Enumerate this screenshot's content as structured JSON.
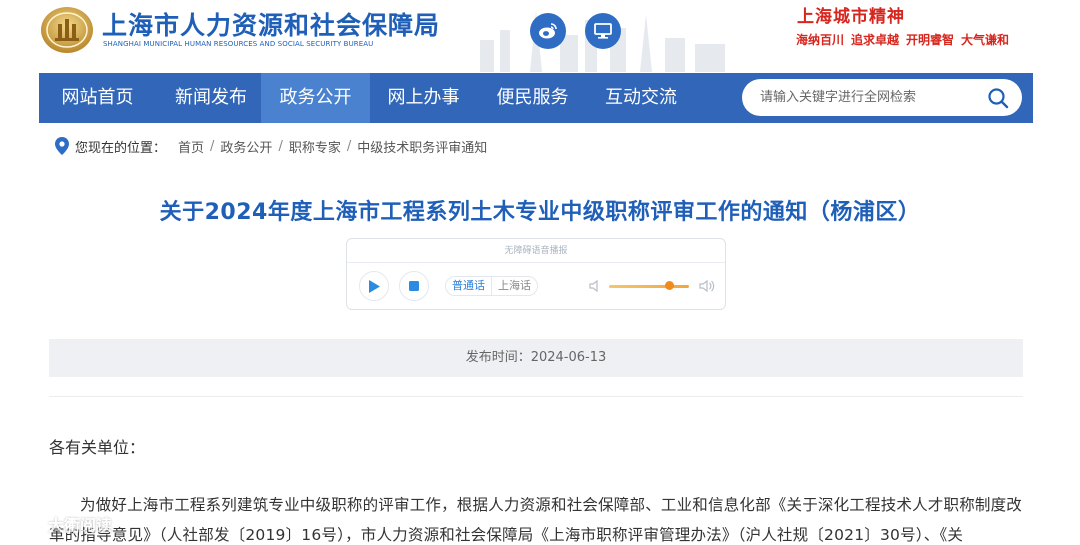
{
  "header": {
    "title": "上海市人力资源和社会保障局",
    "subtitle": "SHANGHAI MUNICIPAL HUMAN RESOURCES AND SOCIAL SECURITY BUREAU",
    "weibo_icon": "weibo-icon",
    "desktop_icon": "desktop-icon",
    "spirit": {
      "title": "上海城市精神",
      "phrases": [
        "海纳百川",
        "追求卓越",
        "开明睿智",
        "大气谦和"
      ]
    }
  },
  "nav": {
    "items": [
      {
        "label": "网站首页"
      },
      {
        "label": "新闻发布"
      },
      {
        "label": "政务公开",
        "active": true
      },
      {
        "label": "网上办事"
      },
      {
        "label": "便民服务"
      },
      {
        "label": "互动交流"
      }
    ],
    "search": {
      "placeholder": "请输入关键字进行全网检索"
    }
  },
  "breadcrumb": {
    "location_label": "您现在的位置：",
    "items": [
      "首页",
      "政务公开",
      "职称专家",
      "中级技术职务评审通知"
    ]
  },
  "article": {
    "title": "关于2024年度上海市工程系列土木专业中级职称评审工作的通知（杨浦区）",
    "publish": "发布时间：2024-06-13",
    "salutation": "各有关单位：",
    "paragraph": "为做好上海市工程系列建筑专业中级职称的评审工作，根据人力资源和社会保障部、工业和信息化部《关于深化工程技术人才职称制度改革的指导意见》（人社部发〔2019〕16号），市人力资源和社会保障局《上海市职称评审管理办法》（沪人社规〔2021〕30号）、《关"
  },
  "player": {
    "header": "无障碍语音播报",
    "lang_selected": "普通话",
    "lang_other": "上海话",
    "volume_level": 0.75
  },
  "watermark": "大衢阅读",
  "colors": {
    "brand_blue": "#1f5fb8",
    "nav_blue": "#3266b8",
    "nav_active": "#4b82cf",
    "spirit_red": "#d7261e"
  }
}
